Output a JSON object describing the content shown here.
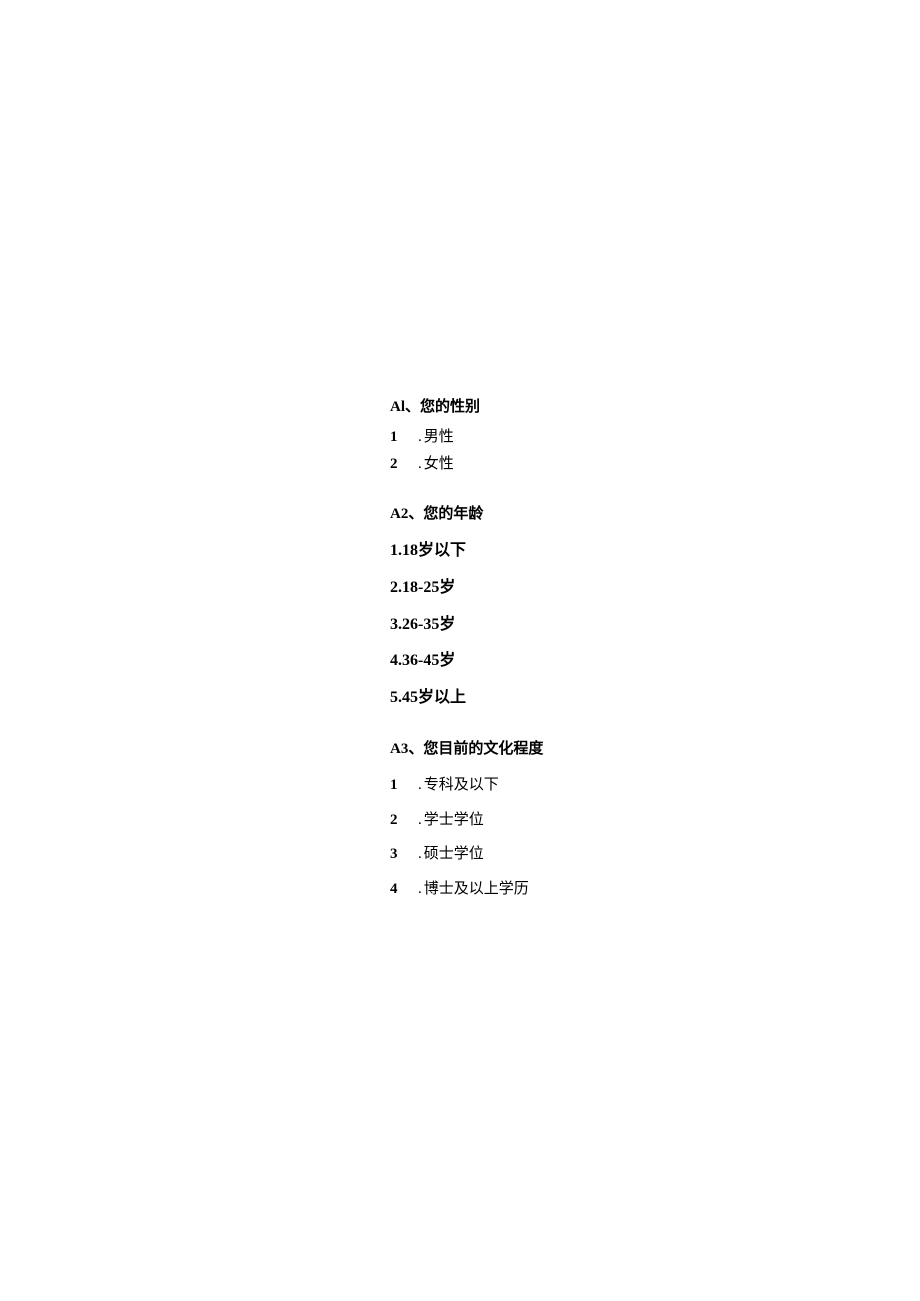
{
  "q1": {
    "prompt": "Al、您的性别",
    "options": [
      {
        "n": "1",
        "dot": ".",
        "label": "男性"
      },
      {
        "n": "2",
        "dot": ".",
        "label": "女性"
      }
    ]
  },
  "q2": {
    "prompt": "A2、您的年龄",
    "options": [
      {
        "text": "1.18岁以下"
      },
      {
        "text": "2.18-25岁"
      },
      {
        "text": "3.26-35岁"
      },
      {
        "text": "4.36-45岁"
      },
      {
        "text": "5.45岁以上"
      }
    ]
  },
  "q3": {
    "prompt": "A3、您目前的文化程度",
    "options": [
      {
        "n": "1",
        "dot": ".",
        "label": "专科及以下"
      },
      {
        "n": "2",
        "dot": ".",
        "label": "学士学位"
      },
      {
        "n": "3",
        "dot": ".",
        "label": "硕士学位"
      },
      {
        "n": "4",
        "dot": ".",
        "label": "博士及以上学历"
      }
    ]
  }
}
